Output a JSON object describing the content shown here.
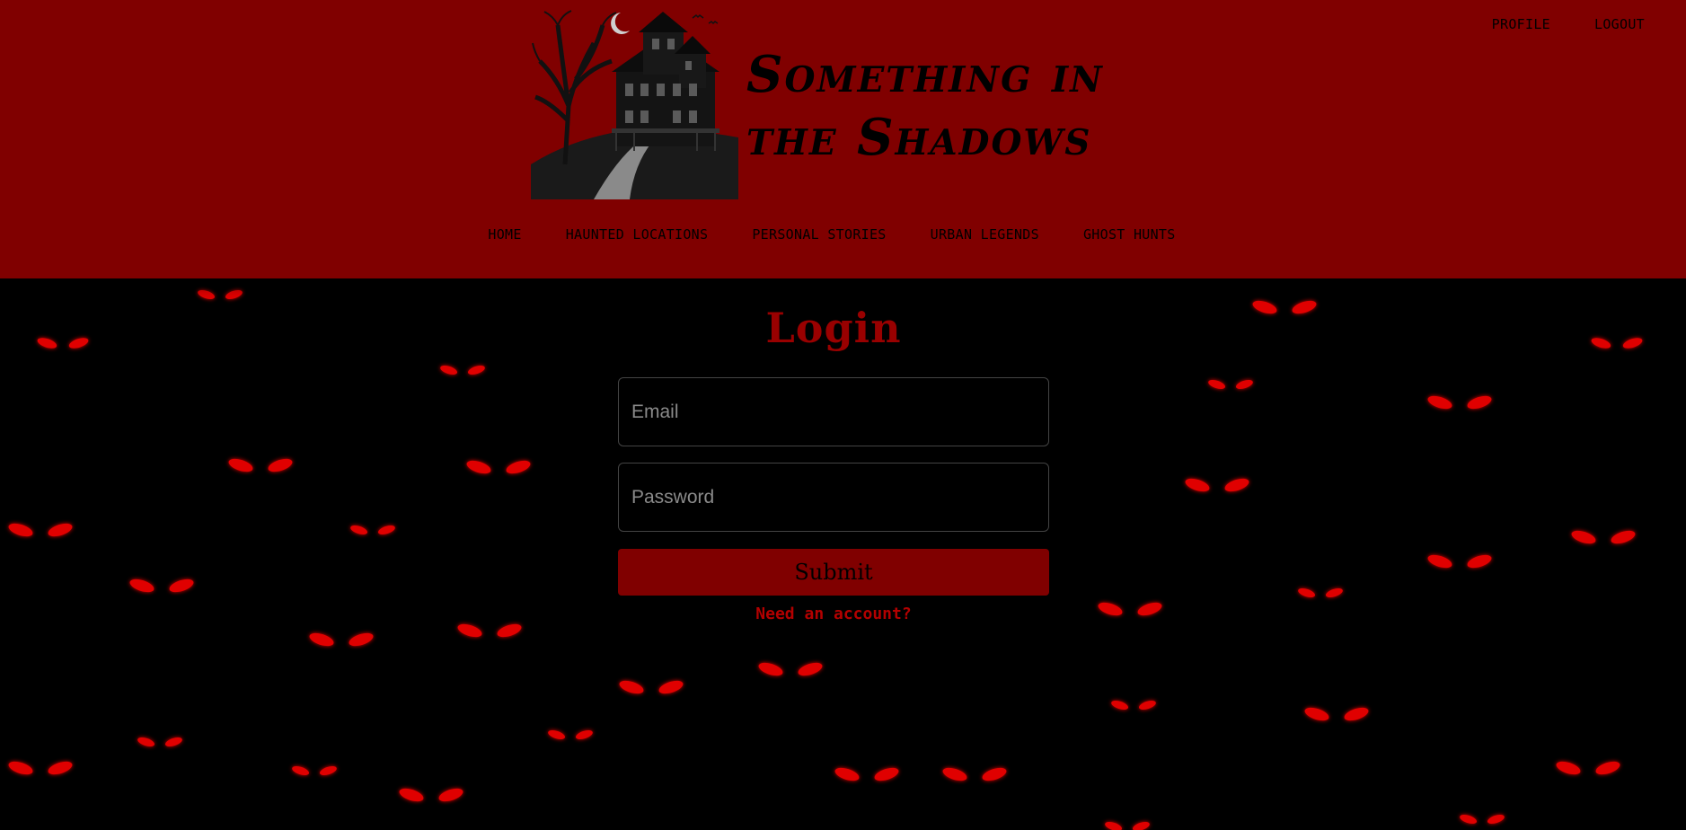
{
  "site": {
    "title_line1": "Something in",
    "title_line2": "the Shadows",
    "logo_icon": "haunted-house-icon"
  },
  "topnav": {
    "profile": "PROFILE",
    "logout": "LOGOUT"
  },
  "mainnav": {
    "items": [
      "HOME",
      "HAUNTED LOCATIONS",
      "PERSONAL STORIES",
      "URBAN LEGENDS",
      "GHOST HUNTS"
    ]
  },
  "login": {
    "heading": "Login",
    "email_placeholder": "Email",
    "password_placeholder": "Password",
    "submit_label": "Submit",
    "signup_link": "Need an account?"
  },
  "colors": {
    "header_bg": "#800000",
    "page_bg": "#000000",
    "accent": "#990000",
    "eyes": "#e00000"
  }
}
